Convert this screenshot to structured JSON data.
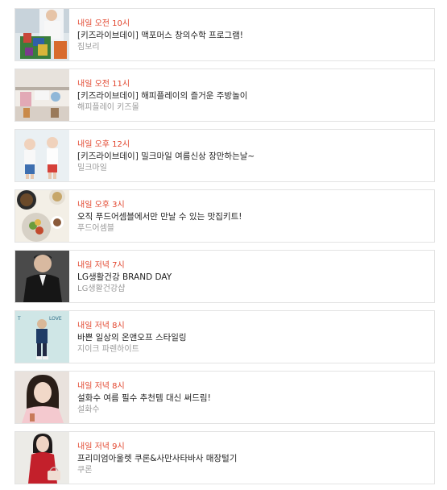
{
  "schedule": {
    "items": [
      {
        "time": "내일 오전 10시",
        "title": "[키즈라이브데이] 맥포머스 창의수학 프로그램!",
        "brand": "짐보리"
      },
      {
        "time": "내일 오전 11시",
        "title": "[키즈라이브데이] 해피플레이의 즐거운 주방놀이",
        "brand": "해피플레이 키즈몰"
      },
      {
        "time": "내일 오후 12시",
        "title": "[키즈라이브데이] 밀크마일 여름신상 장만하는날~",
        "brand": "밀크마일"
      },
      {
        "time": "내일 오후 3시",
        "title": "오직 푸드어셈블에서만 만날 수 있는 맛집키트!",
        "brand": "푸드어셈블"
      },
      {
        "time": "내일 저녁 7시",
        "title": "LG생활건강 BRAND DAY",
        "brand": "LG생활건강샵"
      },
      {
        "time": "내일 저녁 8시",
        "title": "바쁜 일상의 온앤오프 스타일링",
        "brand": "지이크 파렌하이트"
      },
      {
        "time": "내일 저녁 8시",
        "title": "설화수 여름 필수 추천템 대신 써드림!",
        "brand": "설화수"
      },
      {
        "time": "내일 저녁 9시",
        "title": "프리미엄아울렛 쿠론&사만사타바사 매장털기",
        "brand": "쿠론"
      }
    ]
  },
  "thumbnail_text": {
    "love": "LOVE",
    "t_letter": "T"
  }
}
